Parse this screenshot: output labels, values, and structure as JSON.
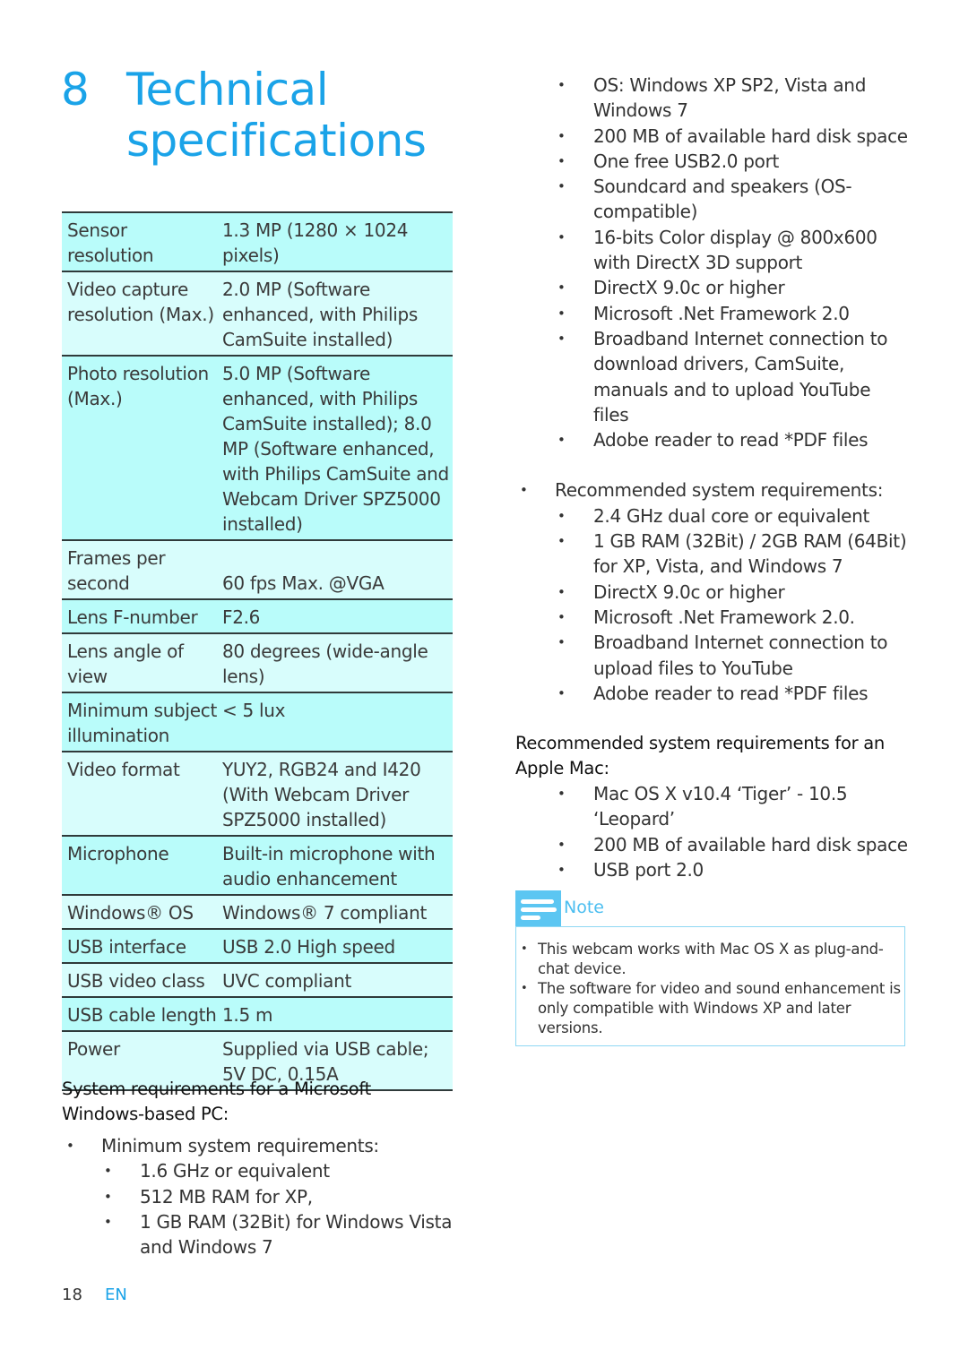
{
  "title": {
    "number": "8",
    "text": "Technical specifications"
  },
  "specs": [
    {
      "label": "Sensor resolution",
      "value": "1.3 MP (1280 × 1024 pixels)"
    },
    {
      "label": "Video capture resolution (Max.)",
      "value": "2.0 MP (Software enhanced, with Philips CamSuite installed)"
    },
    {
      "label": "Photo resolution (Max.)",
      "value": "5.0 MP (Software enhanced, with Philips CamSuite installed); 8.0 MP (Software enhanced, with Philips CamSuite and Webcam Driver SPZ5000 installed)"
    },
    {
      "label": "Frames per second",
      "value": "60 fps Max. @VGA"
    },
    {
      "label": "Lens F-number",
      "value": "F2.6"
    },
    {
      "label": "Lens angle of view",
      "value": "80 degrees (wide-angle lens)"
    },
    {
      "label": "Minimum subject illumination",
      "value": "< 5 lux"
    },
    {
      "label": "Video format",
      "value": "YUY2, RGB24 and I420 (With Webcam Driver SPZ5000 installed)"
    },
    {
      "label": "Microphone",
      "value": "Built-in microphone with audio enhancement"
    },
    {
      "label": "Windows® OS",
      "value": "Windows® 7 compliant"
    },
    {
      "label": "USB interface",
      "value": "USB 2.0 High speed"
    },
    {
      "label": "USB video class",
      "value": "UVC compliant"
    },
    {
      "label": "USB cable length",
      "value": "1.5 m"
    },
    {
      "label": "Power",
      "value": "Supplied via USB cable; 5V DC, 0.15A"
    }
  ],
  "windows": {
    "heading": "System requirements for a Microsoft Windows-based PC:",
    "minimum": {
      "label": "Minimum system requirements:",
      "items": [
        "1.6 GHz or equivalent",
        "512 MB RAM for XP,",
        "1 GB RAM (32Bit) for Windows Vista and Windows 7",
        "OS: Windows XP SP2, Vista and Windows 7",
        "200 MB of available hard disk space",
        "One free USB2.0 port",
        "Soundcard and speakers (OS-compatible)",
        "16-bits Color display @ 800x600 with DirectX 3D support",
        "DirectX 9.0c or higher",
        "Microsoft .Net Framework 2.0",
        "Broadband Internet connection to download drivers, CamSuite, manuals and to upload YouTube files",
        "Adobe reader to read *PDF files"
      ]
    },
    "recommended": {
      "label": "Recommended system requirements:",
      "items": [
        "2.4 GHz dual core or equivalent",
        "1 GB RAM (32Bit) / 2GB RAM (64Bit) for XP, Vista, and Windows 7",
        "DirectX 9.0c or higher",
        "Microsoft .Net Framework 2.0.",
        "Broadband Internet connection to upload files to YouTube",
        "Adobe reader to read *PDF files"
      ]
    }
  },
  "mac": {
    "heading": "Recommended system requirements for an Apple Mac:",
    "items": [
      "Mac OS X v10.4 ‘Tiger’ - 10.5 ‘Leopard’",
      "200 MB of available hard disk space",
      "USB port 2.0"
    ]
  },
  "note": {
    "title": "Note",
    "icon": "note-icon",
    "items": [
      "This webcam works with Mac OS X as plug-and-chat device.",
      "The software for video and sound enhancement is only compatible with Windows XP and later versions."
    ]
  },
  "footer": {
    "page_number": "18",
    "language": "EN"
  },
  "colors": {
    "accent": "#1aa3e8",
    "row_odd": "#b9fcfa",
    "row_even": "#d8fdfc",
    "note_tab": "#5cc6f2"
  }
}
